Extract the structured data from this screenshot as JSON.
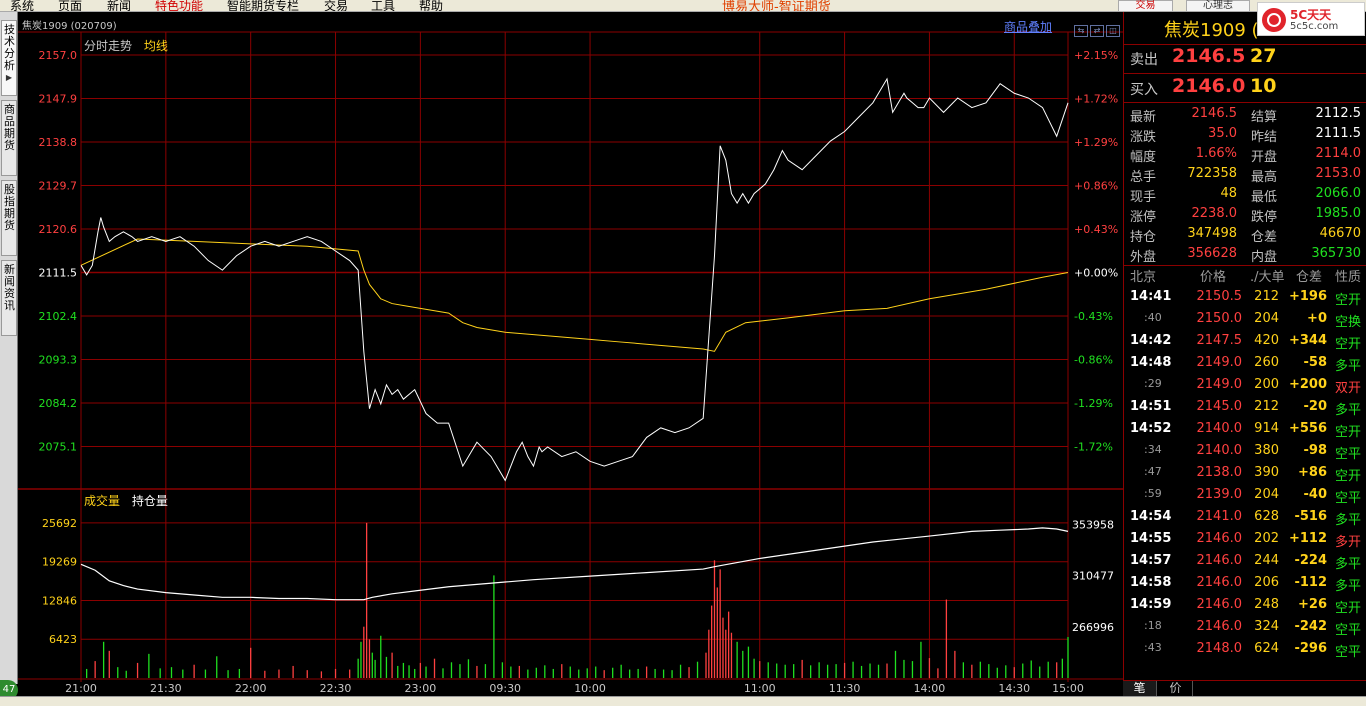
{
  "menu": [
    {
      "label": "系统"
    },
    {
      "label": "页面"
    },
    {
      "label": "新闻"
    },
    {
      "label": "特色功能",
      "special": true
    },
    {
      "label": "智能期货专栏"
    },
    {
      "label": "交易"
    },
    {
      "label": "工具"
    },
    {
      "label": "帮助"
    }
  ],
  "app_brand": "博易大师-智证期货",
  "trade_button": "交易",
  "mood_button": "心理志",
  "left_tabs": [
    {
      "label": "技术分析",
      "active": true
    },
    {
      "label": "商品期货"
    },
    {
      "label": "股指期货"
    },
    {
      "label": "新闻资讯"
    }
  ],
  "badge": "47",
  "chart_header": {
    "symbol_info": "焦炭1909 (020709)",
    "overlay": "商品叠加",
    "price_title": "分时走势",
    "price_avg_legend": "均线",
    "volume_title": "成交量",
    "oi_legend": "持仓量"
  },
  "colors": {
    "up": "#ff4040",
    "down": "#20e020",
    "grid": "#8b0000",
    "price": "#ffffff",
    "avg": "#ffd21a",
    "label_yellow": "#ffd21a"
  },
  "chart_data": {
    "type": "line",
    "title": "分时走势",
    "price_axis": {
      "ticks": [
        2157.0,
        2147.9,
        2138.8,
        2129.7,
        2120.6,
        2111.5,
        2102.4,
        2093.3,
        2084.2,
        2075.1
      ],
      "ylim": [
        2066.0,
        2157.0
      ],
      "base": 2111.5
    },
    "pct_axis": {
      "ticks": [
        "+2.15%",
        "+1.72%",
        "+1.29%",
        "+0.86%",
        "+0.43%",
        "+0.00%",
        "-0.43%",
        "-0.86%",
        "-1.29%",
        "-1.72%"
      ]
    },
    "x_ticks": [
      "21:00",
      "21:30",
      "22:00",
      "22:30",
      "23:00",
      "09:30",
      "10:00",
      "11:00",
      "11:30",
      "14:00",
      "14:30",
      "15:00"
    ],
    "series": [
      {
        "name": "分时走势",
        "x": [
          0,
          2,
          4,
          6,
          7,
          8,
          10,
          12,
          15,
          18,
          20,
          25,
          30,
          35,
          40,
          45,
          50,
          55,
          60,
          65,
          70,
          75,
          80,
          85,
          90,
          95,
          98,
          100,
          102,
          104,
          106,
          108,
          110,
          112,
          114,
          118,
          122,
          126,
          130,
          135,
          140,
          145,
          150,
          152,
          154,
          156,
          158,
          160,
          162,
          163,
          165,
          170,
          175,
          180,
          185,
          190,
          195,
          200,
          205,
          210,
          215,
          220,
          224,
          226,
          228,
          230,
          232,
          234,
          236,
          238,
          240,
          242,
          245,
          248,
          250,
          255,
          260,
          265,
          270,
          275,
          280,
          285,
          287,
          289,
          291,
          292,
          294,
          296,
          298,
          300,
          305,
          310,
          315,
          320,
          325,
          330,
          335,
          340,
          345,
          349
        ],
        "values": [
          2113,
          2111,
          2113,
          2120,
          2123,
          2121,
          2118,
          2119,
          2120,
          2119,
          2118,
          2119,
          2118,
          2119,
          2117,
          2114,
          2112,
          2115,
          2117,
          2118,
          2117,
          2118,
          2119,
          2118,
          2116,
          2114,
          2112,
          2095,
          2083,
          2087,
          2084,
          2088,
          2086,
          2087,
          2085,
          2087,
          2082,
          2080,
          2080,
          2071,
          2076,
          2073,
          2068,
          2071,
          2074,
          2076,
          2073,
          2071,
          2075,
          2074,
          2075,
          2073,
          2074,
          2072,
          2071,
          2072,
          2073,
          2077,
          2079,
          2078,
          2079,
          2081,
          2115,
          2138,
          2135,
          2128,
          2126,
          2128,
          2126,
          2128,
          2129,
          2130,
          2133,
          2137,
          2135,
          2133,
          2136,
          2139,
          2141,
          2144,
          2147,
          2152,
          2145,
          2147,
          2149,
          2148,
          2147,
          2146,
          2146,
          2148,
          2145,
          2148,
          2146,
          2147,
          2151,
          2149,
          2148,
          2146,
          2140,
          2147
        ]
      },
      {
        "name": "均线",
        "x": [
          0,
          20,
          40,
          60,
          80,
          98,
          100,
          102,
          104,
          106,
          110,
          115,
          120,
          130,
          135,
          140,
          150,
          160,
          170,
          180,
          190,
          200,
          210,
          220,
          224,
          228,
          235,
          250,
          270,
          285,
          300,
          320,
          340,
          349
        ],
        "values": [
          2113,
          2118.5,
          2118,
          2117.5,
          2117,
          2116,
          2112,
          2109,
          2107.5,
          2106,
          2105,
          2104.5,
          2104,
          2103,
          2101,
          2100,
          2099,
          2098.5,
          2098,
          2097.5,
          2097,
          2096.5,
          2096,
          2095.5,
          2095,
          2099,
          2101,
          2102,
          2103.5,
          2104,
          2106,
          2108,
          2110.5,
          2111.5
        ]
      }
    ],
    "volume_axis": {
      "ticks": [
        25692,
        19269,
        12846,
        6423
      ],
      "ylim": [
        0,
        28000
      ]
    },
    "oi_axis": {
      "ticks": [
        353958,
        310477,
        266996
      ],
      "ylim": [
        223515,
        367000
      ]
    },
    "volume": {
      "x": [
        2,
        5,
        8,
        10,
        13,
        16,
        20,
        24,
        28,
        32,
        36,
        40,
        44,
        48,
        52,
        56,
        60,
        65,
        70,
        75,
        80,
        85,
        90,
        95,
        98,
        99,
        100,
        101,
        102,
        103,
        104,
        106,
        108,
        110,
        112,
        114,
        116,
        118,
        120,
        122,
        125,
        128,
        131,
        134,
        137,
        140,
        143,
        146,
        149,
        152,
        155,
        158,
        161,
        164,
        167,
        170,
        173,
        176,
        179,
        182,
        185,
        188,
        191,
        194,
        197,
        200,
        203,
        206,
        209,
        212,
        215,
        218,
        221,
        222,
        223,
        224,
        225,
        226,
        227,
        228,
        229,
        230,
        232,
        234,
        236,
        238,
        240,
        243,
        246,
        249,
        252,
        255,
        258,
        261,
        264,
        267,
        270,
        273,
        276,
        279,
        282,
        285,
        288,
        291,
        294,
        297,
        300,
        303,
        306,
        309,
        312,
        315,
        318,
        321,
        324,
        327,
        330,
        333,
        336,
        339,
        342,
        345,
        347,
        349
      ],
      "values": [
        1500,
        2800,
        6000,
        4500,
        1800,
        1200,
        2500,
        4000,
        1600,
        1800,
        1400,
        2200,
        1400,
        3600,
        1300,
        1500,
        5000,
        1200,
        1400,
        2000,
        1300,
        1100,
        1500,
        1400,
        3200,
        6000,
        8500,
        25692,
        6400,
        4200,
        3000,
        7000,
        3500,
        4200,
        2000,
        2500,
        2100,
        1500,
        2500,
        1900,
        3200,
        1600,
        2600,
        2300,
        3100,
        2000,
        2300,
        17000,
        2600,
        1900,
        2000,
        1400,
        1700,
        2100,
        1500,
        2300,
        1900,
        1400,
        1600,
        1900,
        1300,
        1700,
        2200,
        1400,
        1500,
        1900,
        1500,
        1400,
        1300,
        2200,
        1800,
        2700,
        4200,
        8000,
        12000,
        19500,
        15000,
        18000,
        10000,
        8000,
        11000,
        7500,
        6000,
        4500,
        5200,
        3200,
        2800,
        2600,
        2400,
        2200,
        2300,
        3000,
        2100,
        2600,
        2200,
        2300,
        2500,
        2700,
        2000,
        2400,
        2200,
        2400,
        4500,
        3000,
        2800,
        6000,
        3300,
        1600,
        13000,
        4500,
        2600,
        2200,
        2700,
        2300,
        1700,
        2100,
        1800,
        2400,
        2900,
        1900,
        2700,
        2600,
        3200,
        6800
      ]
    },
    "open_interest": {
      "x": [
        0,
        5,
        10,
        15,
        20,
        30,
        40,
        50,
        60,
        70,
        80,
        90,
        100,
        103,
        110,
        120,
        130,
        140,
        150,
        160,
        180,
        200,
        220,
        224,
        240,
        260,
        280,
        300,
        315,
        325,
        335,
        340,
        345,
        349
      ],
      "values": [
        320000,
        315000,
        306000,
        302000,
        299000,
        296000,
        294000,
        292000,
        292000,
        291000,
        291000,
        290000,
        290000,
        292000,
        295000,
        298000,
        301000,
        303000,
        305000,
        307000,
        310000,
        313000,
        316000,
        318000,
        325000,
        332000,
        339000,
        344000,
        348000,
        349000,
        350000,
        351000,
        350000,
        348000
      ]
    }
  },
  "quote": {
    "title": "焦炭1909 (",
    "ask_label": "卖出",
    "ask_price": "2146.5",
    "ask_vol": "27",
    "bid_label": "买入",
    "bid_price": "2146.0",
    "bid_vol": "10",
    "stats": [
      {
        "l1": "最新",
        "v1": "2146.5",
        "c1": "red",
        "l2": "结算",
        "v2": "2112.5",
        "c2": "white"
      },
      {
        "l1": "涨跌",
        "v1": "35.0",
        "c1": "red",
        "l2": "昨结",
        "v2": "2111.5",
        "c2": "white"
      },
      {
        "l1": "幅度",
        "v1": "1.66%",
        "c1": "red",
        "l2": "开盘",
        "v2": "2114.0",
        "c2": "red"
      },
      {
        "l1": "总手",
        "v1": "722358",
        "c1": "yellow",
        "l2": "最高",
        "v2": "2153.0",
        "c2": "red"
      },
      {
        "l1": "现手",
        "v1": "48",
        "c1": "yellow",
        "l2": "最低",
        "v2": "2066.0",
        "c2": "green"
      },
      {
        "l1": "涨停",
        "v1": "2238.0",
        "c1": "red",
        "l2": "跌停",
        "v2": "1985.0",
        "c2": "green"
      },
      {
        "l1": "持仓",
        "v1": "347498",
        "c1": "yellow",
        "l2": "仓差",
        "v2": "46670",
        "c2": "yellow"
      },
      {
        "l1": "外盘",
        "v1": "356628",
        "c1": "red",
        "l2": "内盘",
        "v2": "365730",
        "c2": "green"
      }
    ],
    "ticks_header": {
      "time": "北京",
      "price": "价格",
      "vol": "./大单",
      "diff": "仓差",
      "nature": "性质"
    },
    "ticks": [
      {
        "time": "14:41",
        "price": "2150.5",
        "vol": "212",
        "diff": "+196",
        "nature": "空开",
        "major": true
      },
      {
        "time": ":40",
        "price": "2150.0",
        "vol": "204",
        "diff": "+0",
        "nature": "空换",
        "major": false
      },
      {
        "time": "14:42",
        "price": "2147.5",
        "vol": "420",
        "diff": "+344",
        "nature": "空开",
        "major": true
      },
      {
        "time": "14:48",
        "price": "2149.0",
        "vol": "260",
        "diff": "-58",
        "nature": "多平",
        "major": true
      },
      {
        "time": ":29",
        "price": "2149.0",
        "vol": "200",
        "diff": "+200",
        "nature": "双开",
        "major": false
      },
      {
        "time": "14:51",
        "price": "2145.0",
        "vol": "212",
        "diff": "-20",
        "nature": "多平",
        "major": true
      },
      {
        "time": "14:52",
        "price": "2140.0",
        "vol": "914",
        "diff": "+556",
        "nature": "空开",
        "major": true
      },
      {
        "time": ":34",
        "price": "2140.0",
        "vol": "380",
        "diff": "-98",
        "nature": "空平",
        "major": false
      },
      {
        "time": ":47",
        "price": "2138.0",
        "vol": "390",
        "diff": "+86",
        "nature": "空开",
        "major": false
      },
      {
        "time": ":59",
        "price": "2139.0",
        "vol": "204",
        "diff": "-40",
        "nature": "空平",
        "major": false
      },
      {
        "time": "14:54",
        "price": "2141.0",
        "vol": "628",
        "diff": "-516",
        "nature": "多平",
        "major": true
      },
      {
        "time": "14:55",
        "price": "2146.0",
        "vol": "202",
        "diff": "+112",
        "nature": "多开",
        "major": true
      },
      {
        "time": "14:57",
        "price": "2146.0",
        "vol": "244",
        "diff": "-224",
        "nature": "多平",
        "major": true
      },
      {
        "time": "14:58",
        "price": "2146.0",
        "vol": "206",
        "diff": "-112",
        "nature": "多平",
        "major": true
      },
      {
        "time": "14:59",
        "price": "2146.0",
        "vol": "248",
        "diff": "+26",
        "nature": "空开",
        "major": true
      },
      {
        "time": ":18",
        "price": "2146.0",
        "vol": "324",
        "diff": "-242",
        "nature": "空平",
        "major": false
      },
      {
        "time": ":43",
        "price": "2148.0",
        "vol": "624",
        "diff": "-296",
        "nature": "空平",
        "major": false
      }
    ],
    "tabs": [
      "笔",
      "价"
    ]
  },
  "logo": {
    "name": "5C天天",
    "site": "5c5c.com"
  }
}
